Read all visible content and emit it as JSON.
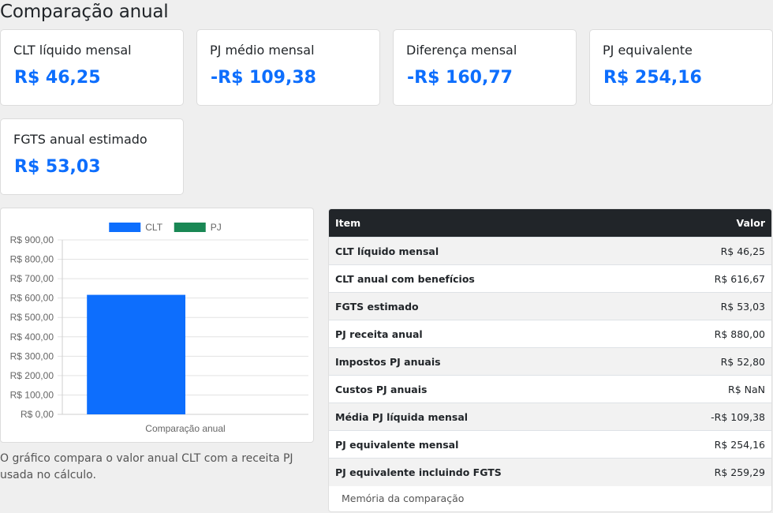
{
  "page": {
    "title": "Comparação anual"
  },
  "cards": [
    {
      "label": "CLT líquido mensal",
      "value": "R$ 46,25"
    },
    {
      "label": "PJ médio mensal",
      "value": "-R$ 109,38"
    },
    {
      "label": "Diferença mensal",
      "value": "-R$ 160,77"
    },
    {
      "label": "PJ equivalente",
      "value": "R$ 254,16"
    },
    {
      "label": "FGTS anual estimado",
      "value": "R$ 53,03"
    }
  ],
  "chart_data": {
    "type": "bar",
    "categories": [
      "Comparação anual"
    ],
    "series": [
      {
        "name": "CLT",
        "values": [
          616.67
        ],
        "color": "#0d6efd"
      },
      {
        "name": "PJ",
        "values": [
          0
        ],
        "color": "#198754"
      }
    ],
    "xlabel": "",
    "ylabel": "",
    "ylim": [
      0,
      900
    ],
    "y_ticks": [
      "R$ 0,00",
      "R$ 100,00",
      "R$ 200,00",
      "R$ 300,00",
      "R$ 400,00",
      "R$ 500,00",
      "R$ 600,00",
      "R$ 700,00",
      "R$ 800,00",
      "R$ 900,00"
    ],
    "legend": "top-center",
    "grid": true
  },
  "chart_note": "O gráfico compara o valor anual CLT com a receita PJ usada no cálculo.",
  "table": {
    "headers": [
      "Item",
      "Valor"
    ],
    "rows": [
      [
        "CLT líquido mensal",
        "R$ 46,25"
      ],
      [
        "CLT anual com benefícios",
        "R$ 616,67"
      ],
      [
        "FGTS estimado",
        "R$ 53,03"
      ],
      [
        "PJ receita anual",
        "R$ 880,00"
      ],
      [
        "Impostos PJ anuais",
        "R$ 52,80"
      ],
      [
        "Custos PJ anuais",
        "R$ NaN"
      ],
      [
        "Média PJ líquida mensal",
        "-R$ 109,38"
      ],
      [
        "PJ equivalente mensal",
        "R$ 254,16"
      ],
      [
        "PJ equivalente incluindo FGTS",
        "R$ 259,29"
      ]
    ],
    "footer": "Memória da comparação"
  }
}
